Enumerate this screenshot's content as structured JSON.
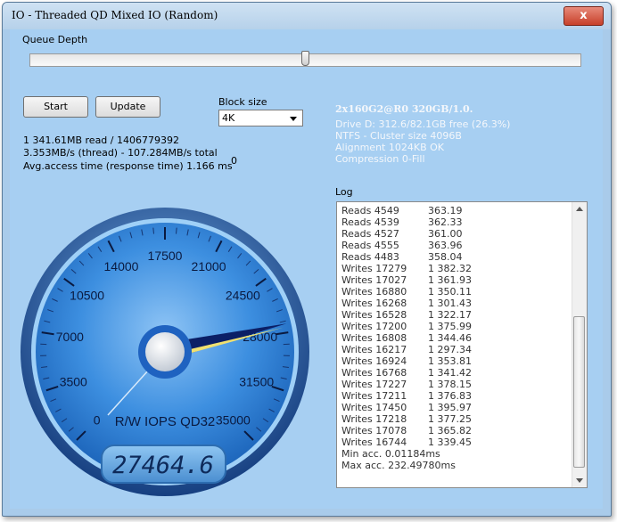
{
  "window": {
    "title": "IO - Threaded QD Mixed IO (Random)",
    "close_glyph": "x"
  },
  "controls": {
    "queue_depth_label": "Queue Depth",
    "queue_depth_level_percent": 50,
    "start_label": "Start",
    "update_label": "Update",
    "block_size_label": "Block size",
    "block_size_value": "4K"
  },
  "stats": {
    "line1": "1 341.61MB read / 1406779392",
    "line2": "3.353MB/s (thread) - 107.284MB/s total",
    "line3": "Avg.access time (response time) 1.166 ms",
    "zero": "0"
  },
  "drive": {
    "name": "2x160G2@R0 320GB/1.0.",
    "line1": "Drive D: 312.6/82.1GB free (26.3%)",
    "line2": "NTFS - Cluster size 4096B",
    "line3": "Alignment 1024KB OK",
    "line4": "Compression 0-Fill"
  },
  "log": {
    "label": "Log",
    "rows": [
      {
        "op": "Reads 4549",
        "val": "363.19"
      },
      {
        "op": "Reads 4539",
        "val": "362.33"
      },
      {
        "op": "Reads 4527",
        "val": "361.00"
      },
      {
        "op": "Reads 4555",
        "val": "363.96"
      },
      {
        "op": "Reads 4483",
        "val": "358.04"
      },
      {
        "op": "Writes 17279",
        "val": "1 382.32"
      },
      {
        "op": "Writes 17027",
        "val": "1 361.93"
      },
      {
        "op": "Writes 16880",
        "val": "1 350.11"
      },
      {
        "op": "Writes 16268",
        "val": "1 301.43"
      },
      {
        "op": "Writes 16528",
        "val": "1 322.17"
      },
      {
        "op": "Writes 17200",
        "val": "1 375.99"
      },
      {
        "op": "Writes 16808",
        "val": "1 344.46"
      },
      {
        "op": "Writes 16217",
        "val": "1 297.34"
      },
      {
        "op": "Writes 16924",
        "val": "1 353.81"
      },
      {
        "op": "Writes 16768",
        "val": "1 341.42"
      },
      {
        "op": "Writes 17227",
        "val": "1 378.15"
      },
      {
        "op": "Writes 17211",
        "val": "1 376.83"
      },
      {
        "op": "Writes 17450",
        "val": "1 395.97"
      },
      {
        "op": "Writes 17218",
        "val": "1 377.25"
      },
      {
        "op": "Writes 17078",
        "val": "1 365.82"
      },
      {
        "op": "Writes 16744",
        "val": "1 339.45"
      }
    ],
    "min_acc": "Min acc. 0.01184ms",
    "max_acc": "Max acc. 232.49780ms"
  },
  "gauge": {
    "title": "R/W IOPS QD32",
    "readout": "27464.6",
    "ticks": [
      "0",
      "3500",
      "7000",
      "10500",
      "14000",
      "17500",
      "21000",
      "24500",
      "28000",
      "31500",
      "35000"
    ],
    "max": 35000,
    "needle_value": 27464.6,
    "colors": {
      "face": "#3a8ee0",
      "rim": "#1a4f9a",
      "needle": "#0b1f66",
      "needle_highlight": "#f0e070"
    }
  }
}
